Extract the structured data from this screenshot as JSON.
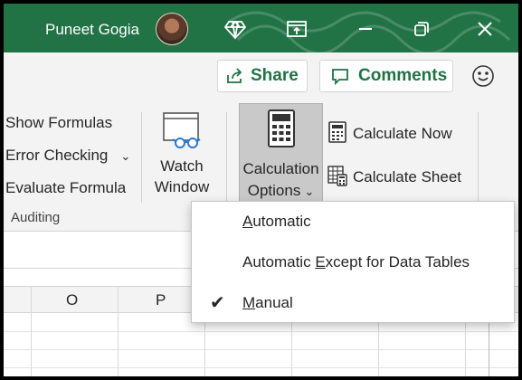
{
  "titlebar": {
    "user_name": "Puneet Gogia"
  },
  "actions": {
    "share_label": "Share",
    "comments_label": "Comments"
  },
  "ribbon": {
    "formula_auditing": {
      "show_formulas": "Show Formulas",
      "error_checking": "Error Checking",
      "evaluate_formula": "Evaluate Formula",
      "group_label": "Auditing"
    },
    "watch_window": {
      "line1": "Watch",
      "line2": "Window"
    },
    "calculation": {
      "options_line1": "Calculation",
      "options_line2": "Options",
      "calculate_now": "Calculate Now",
      "calculate_sheet": "Calculate Sheet"
    }
  },
  "sheet": {
    "columns": [
      "O",
      "P"
    ]
  },
  "calc_menu": {
    "items": [
      {
        "label_pre": "",
        "label_ul": "A",
        "label_post": "utomatic",
        "checked": false
      },
      {
        "label_pre": "Automatic ",
        "label_ul": "E",
        "label_post": "xcept for Data Tables",
        "checked": false
      },
      {
        "label_pre": "",
        "label_ul": "M",
        "label_post": "anual",
        "checked": true
      }
    ],
    "check_glyph": "✔"
  },
  "colors": {
    "title_green": "#217346",
    "ribbon_bg": "#f3f3f3",
    "selected_bg": "#c9c9c9"
  }
}
